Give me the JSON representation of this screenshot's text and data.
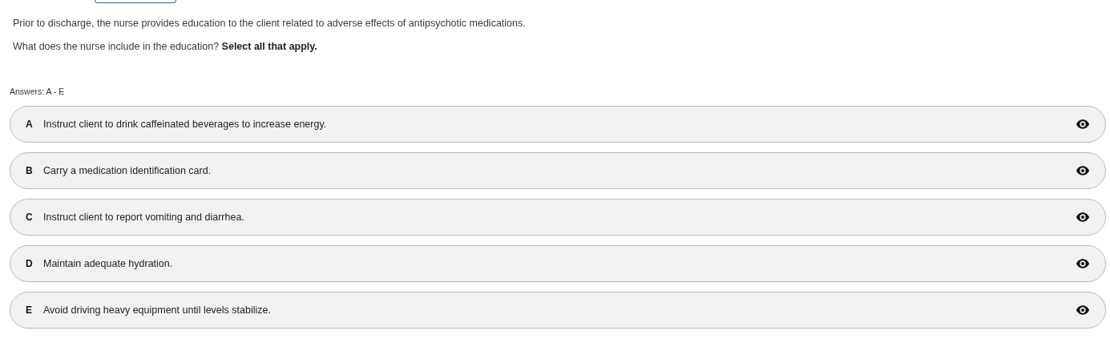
{
  "question": {
    "stem": "Prior to discharge, the nurse provides education to the client related to adverse effects of antipsychotic medications.",
    "prompt": "What does the nurse include in the education? **Select all that apply.**"
  },
  "answers_label": "Answers: A - E",
  "options": [
    {
      "letter": "A",
      "text": "Instruct client to drink caffeinated beverages to increase energy."
    },
    {
      "letter": "B",
      "text": "Carry a medication identification card."
    },
    {
      "letter": "C",
      "text": "Instruct client to report vomiting and diarrhea."
    },
    {
      "letter": "D",
      "text": "Maintain adequate hydration."
    },
    {
      "letter": "E",
      "text": "Avoid driving heavy equipment until levels stabilize."
    }
  ]
}
